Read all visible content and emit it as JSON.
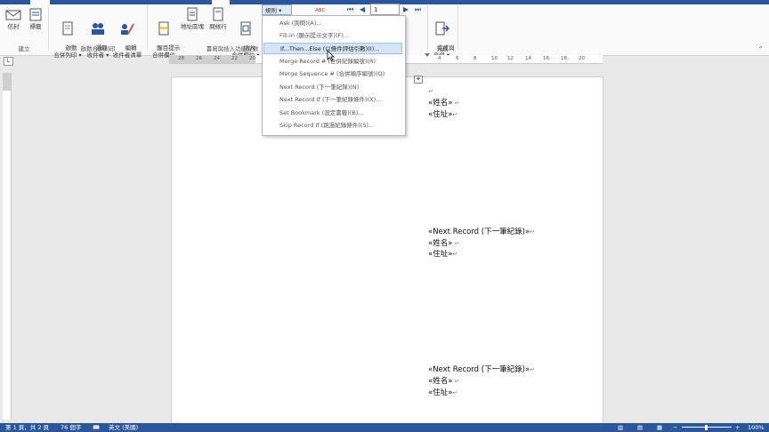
{
  "ribbon": {
    "buttons": {
      "envelope": "信封",
      "labels": "標籤",
      "start_merge": "啟動\n合併列印 ▾",
      "select_recipients": "選取\n收件者 ▾",
      "edit_recipients": "編輯\n收件者清單",
      "highlight_fields": "醒目提示\n合併欄位",
      "address_block": "地址區塊",
      "greeting_line": "問候行",
      "insert_field": "插入\n合併欄位 ▾",
      "finish_merge": "完成與\n合併 ▾"
    },
    "groups": {
      "create": "建立",
      "start": "啟動合併列印",
      "write_insert": "書寫與插入功能變數",
      "finish": "完成"
    },
    "rules_label": "規則 ▾",
    "preview_label": "ABC",
    "record_number": "1"
  },
  "menu": {
    "items": [
      "Ask (詢問)(A)...",
      "Fill-in (顯示提示文字)(F)...",
      "If...Then...Else (以條件評估引數)(I)...",
      "Merge Record # (合併紀錄編號)(R)",
      "Merge Sequence # (合併順序編號)(Q)",
      "Next Record (下一筆紀錄)(N)",
      "Next Record If (下一筆紀錄條件)(X)...",
      "Set Bookmark (設定書籤)(B)...",
      "Skip Record If (跳過紀錄條件)(S)..."
    ],
    "highlighted_index": 2
  },
  "ruler": {
    "left": [
      "28",
      "26",
      "24",
      "22",
      "20"
    ],
    "right": [
      "2",
      "4",
      "6",
      "8",
      "10",
      "12",
      "14",
      "16",
      "18",
      "20"
    ]
  },
  "document": {
    "blocks": [
      [
        "",
        "«姓名»",
        "«住址»"
      ],
      [
        "«Next Record (下一筆紀錄)»",
        "«姓名»",
        "«住址»"
      ],
      [
        "«Next Record (下一筆紀錄)»",
        "«姓名»",
        "«住址»"
      ]
    ]
  },
  "status": {
    "page": "第 1 頁，共 2 頁",
    "words": "76 個字",
    "language": "英文 (美國)",
    "zoom": "100%"
  },
  "colors": {
    "accent": "#2b579a",
    "highlight": "#d5e5f7"
  }
}
